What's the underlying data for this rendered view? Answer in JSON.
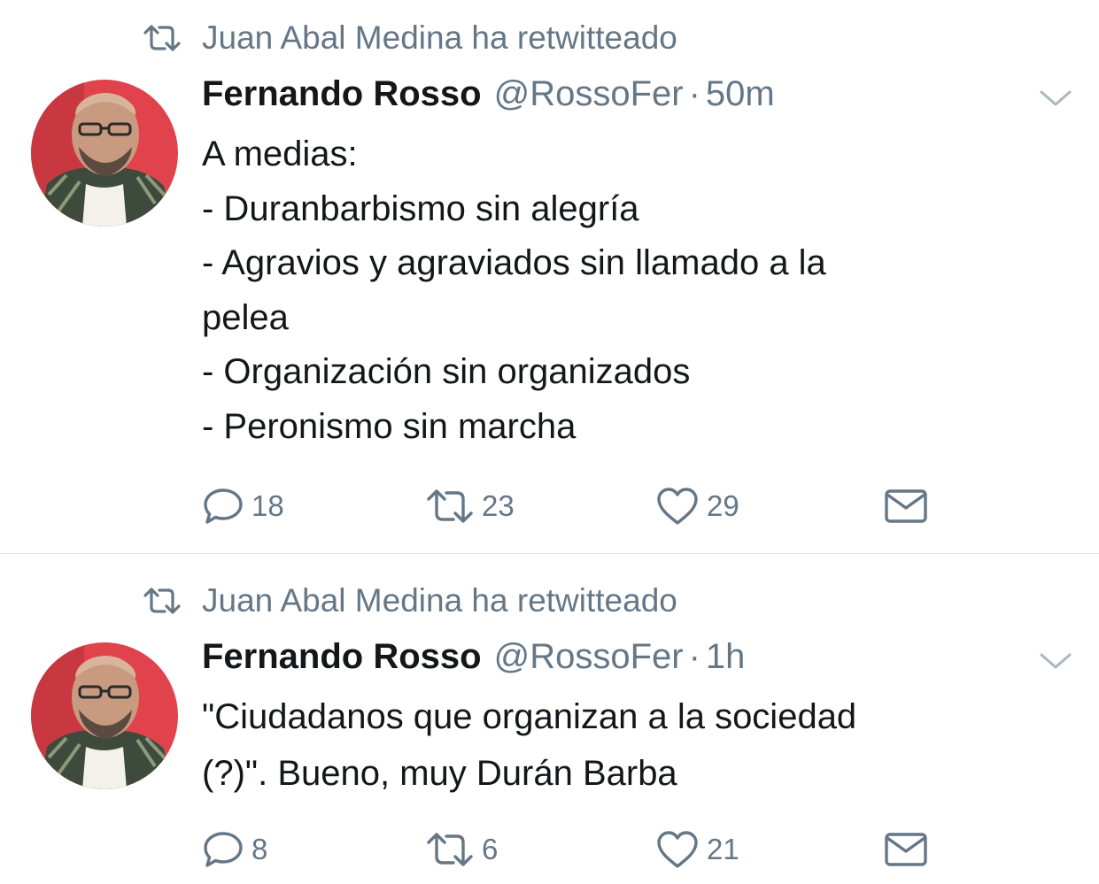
{
  "tweets": [
    {
      "retweeted_by": "Juan Abal Medina ha retwitteado",
      "author_name": "Fernando Rosso",
      "author_handle": "@RossoFer",
      "separator": "·",
      "time": "50m",
      "lines": [
        "A medias:",
        "- Duranbarbismo sin alegría",
        "- Agravios y agraviados sin llamado a la",
        "pelea",
        "- Organización sin organizados",
        "- Peronismo sin marcha"
      ],
      "replies": "18",
      "retweets": "23",
      "likes": "29"
    },
    {
      "retweeted_by": "Juan Abal Medina ha retwitteado",
      "author_name": "Fernando Rosso",
      "author_handle": "@RossoFer",
      "separator": "·",
      "time": "1h",
      "lines": [
        "\"Ciudadanos que organizan a la sociedad",
        "(?)\". Bueno, muy Durán Barba"
      ],
      "replies": "8",
      "retweets": "6",
      "likes": "21"
    }
  ],
  "icons": {
    "retweet": "retweet-icon",
    "reply": "reply-icon",
    "like": "heart-icon",
    "message": "envelope-icon",
    "menu": "chevron-down-icon"
  },
  "colors": {
    "text": "#14171a",
    "secondary": "#657786",
    "divider": "#e1e8ed",
    "avatar_bg": "#e0434b"
  }
}
